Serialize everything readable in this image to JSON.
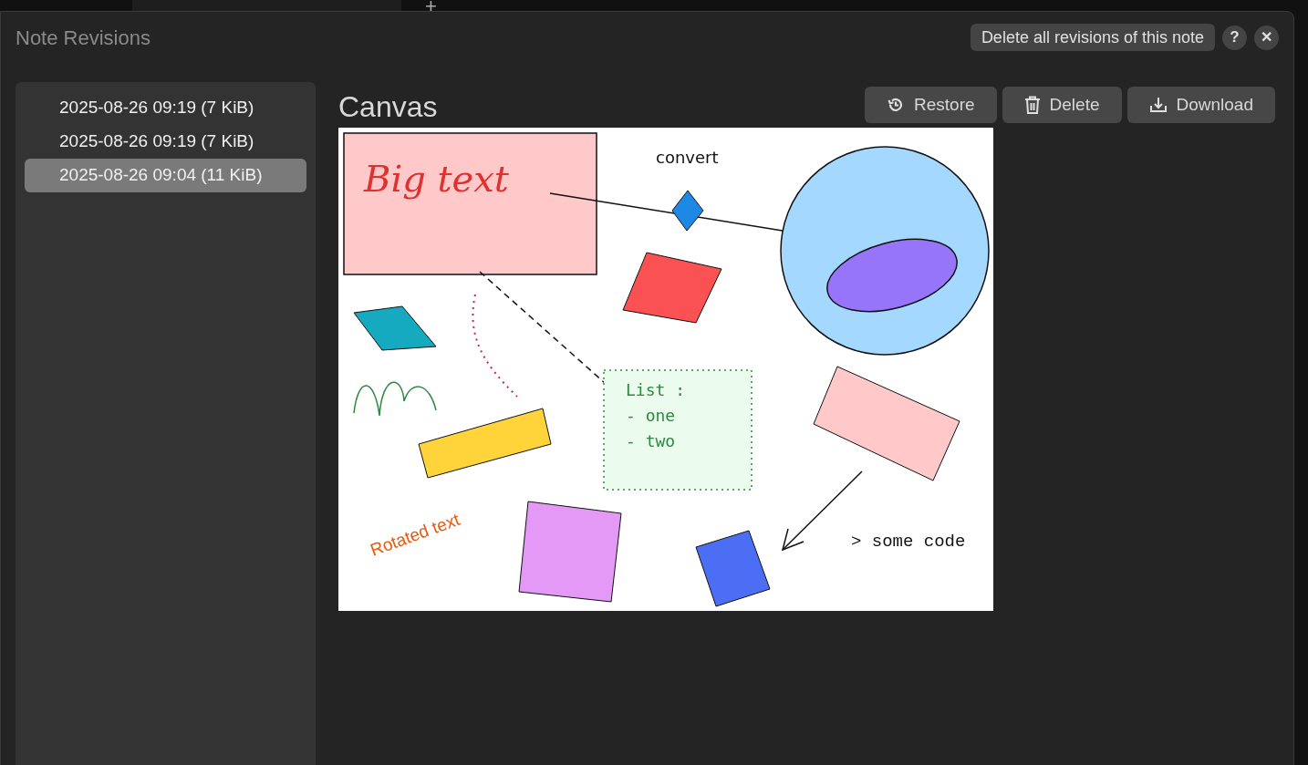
{
  "background_tab": {
    "new_tab": "+"
  },
  "dialog": {
    "title": "Note Revisions",
    "delete_all": "Delete all revisions of this note",
    "help": "?",
    "close": "✕"
  },
  "revisions": [
    {
      "label": "2025-08-26 09:19 (7 KiB)",
      "selected": false
    },
    {
      "label": "2025-08-26 09:19 (7 KiB)",
      "selected": false
    },
    {
      "label": "2025-08-26 09:04 (11 KiB)",
      "selected": true
    }
  ],
  "preview": {
    "title": "Canvas",
    "actions": [
      {
        "kind": "restore",
        "label": "Restore"
      },
      {
        "kind": "delete",
        "label": "Delete"
      },
      {
        "kind": "download",
        "label": "Download"
      }
    ],
    "canvas_texts": [
      "Big text",
      "convert",
      "List :",
      "- one",
      "- two",
      "Rotated text",
      "> some code"
    ]
  }
}
